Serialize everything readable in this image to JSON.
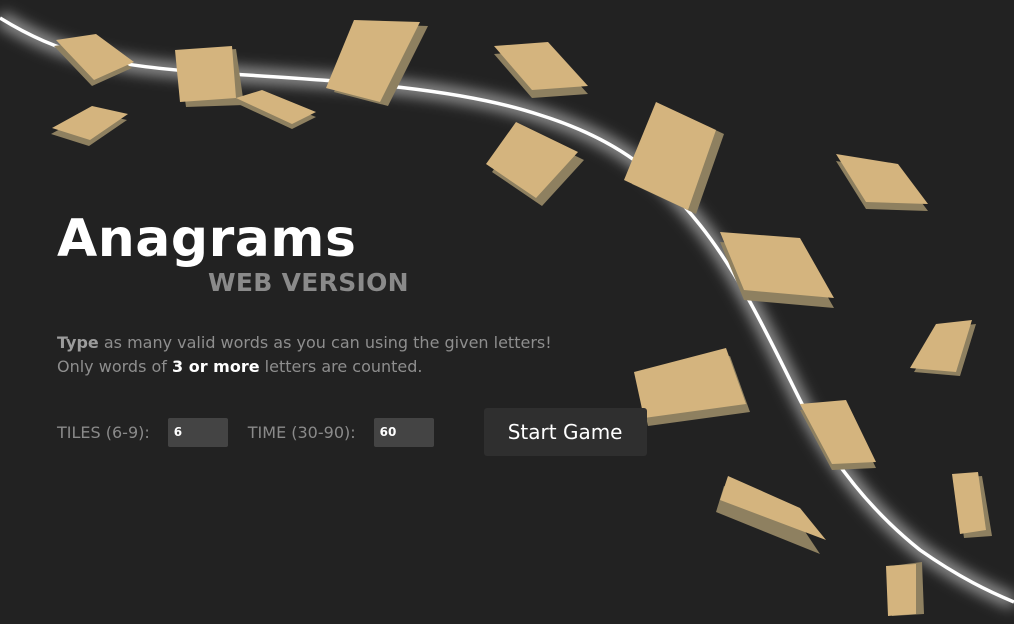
{
  "app": {
    "title": "Anagrams",
    "subtitle": "WEB VERSION"
  },
  "instructions": {
    "line1_bold": "Type",
    "line1_rest": " as many valid words as you can using the given letters!",
    "line2_pre": "Only words of ",
    "line2_bold": "3 or more",
    "line2_post": " letters are counted."
  },
  "settings": {
    "tiles_label": "TILES (6-9):",
    "tiles_value": "6",
    "time_label": "TIME (30-90):",
    "time_value": "60",
    "start_label": "Start Game"
  },
  "colors": {
    "background": "#222222",
    "tile_top": "#d4b47e",
    "tile_side": "#8e8060",
    "glow_line": "#ffffff",
    "button": "#2f2f2f",
    "input": "#444444"
  }
}
